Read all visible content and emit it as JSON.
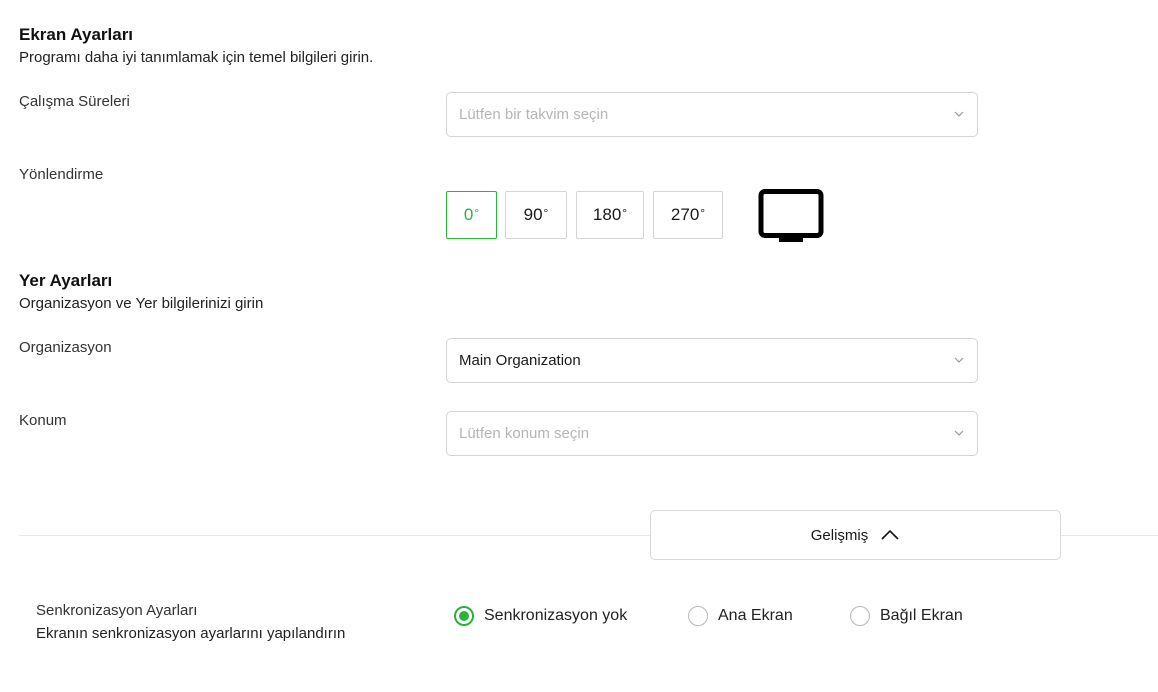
{
  "screen_settings": {
    "title": "Ekran Ayarları",
    "subtitle": "Programı daha iyi tanımlamak için temel bilgileri girin.",
    "working_hours": {
      "label": "Çalışma Süreleri",
      "placeholder": "Lütfen bir takvim seçin"
    },
    "orientation": {
      "label": "Yönlendirme",
      "options": [
        "0",
        "90",
        "180",
        "270"
      ],
      "degree_symbol": "°",
      "selected": "0"
    }
  },
  "location_settings": {
    "title": "Yer Ayarları",
    "subtitle": "Organizasyon ve Yer bilgilerinizi girin",
    "organization": {
      "label": "Organizasyon",
      "value": "Main Organization"
    },
    "location": {
      "label": "Konum",
      "placeholder": "Lütfen konum seçin"
    }
  },
  "advanced": {
    "label": "Gelişmiş"
  },
  "sync": {
    "title": "Senkronizasyon Ayarları",
    "subtitle": "Ekranın senkronizasyon ayarlarını yapılandırın",
    "options": [
      "Senkronizasyon yok",
      "Ana Ekran",
      "Bağıl Ekran"
    ],
    "selected": "Senkronizasyon yok"
  },
  "colors": {
    "accent": "#2ab23a",
    "border": "#d4d4d4",
    "placeholder": "#b5b5b5"
  },
  "icons": {
    "select_chevron": "chevron-down-icon",
    "advanced_toggle": "chevron-up-icon",
    "orientation_preview": "monitor-icon"
  }
}
